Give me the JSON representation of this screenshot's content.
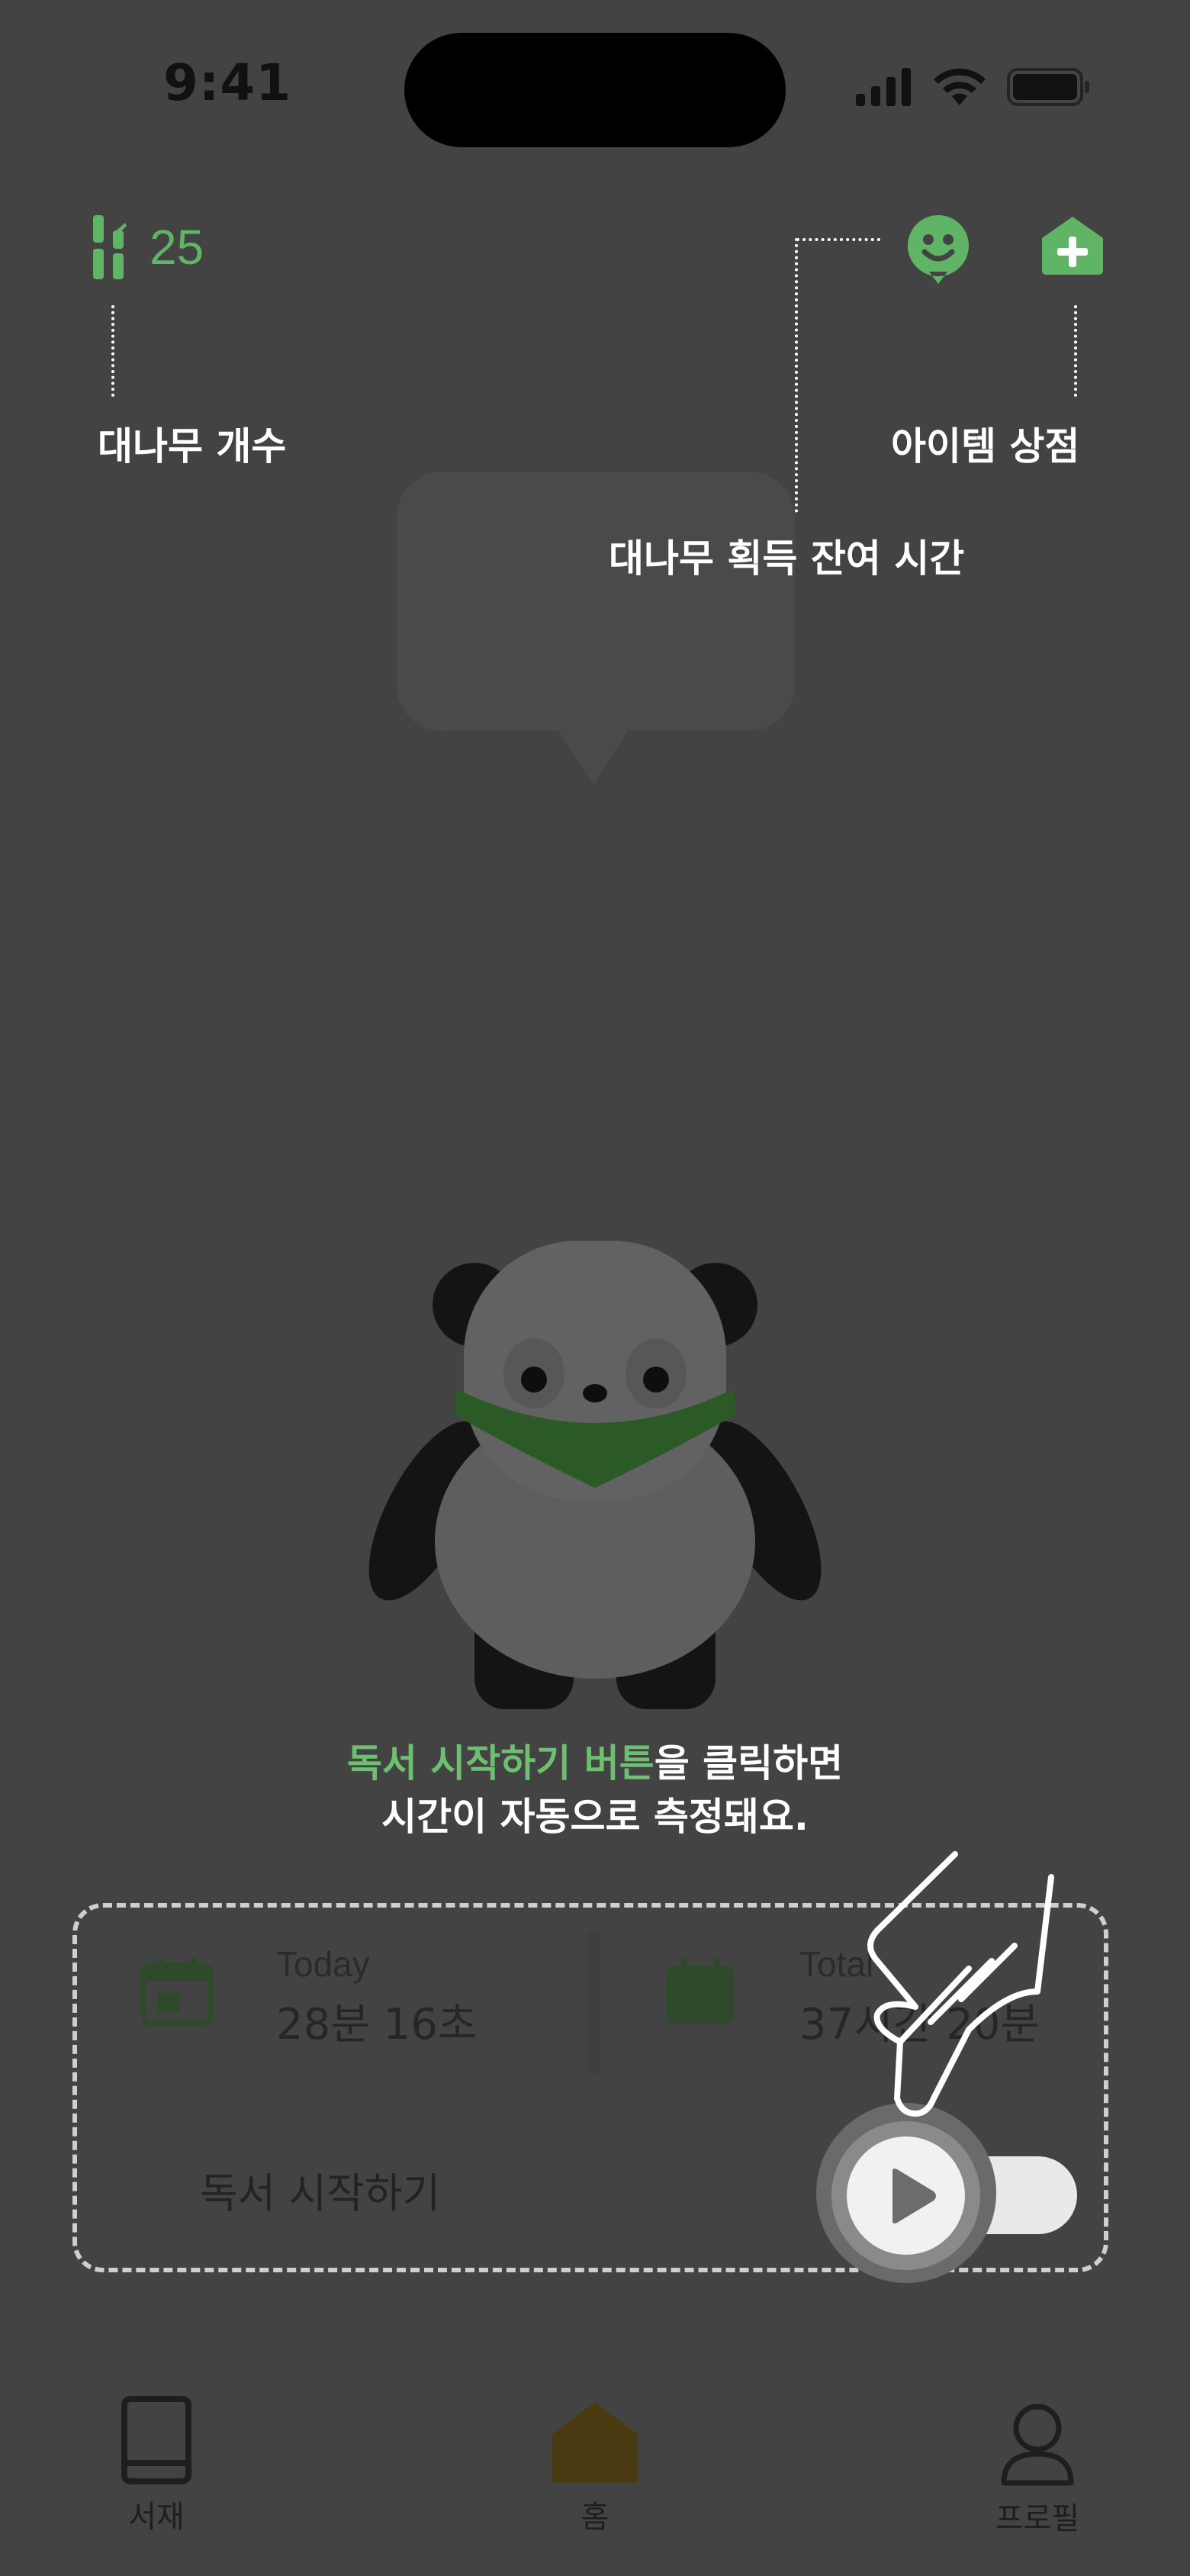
{
  "status_bar": {
    "time": "9:41"
  },
  "top_bar": {
    "bamboo_count": "25"
  },
  "annotations": {
    "bamboo_count_label": "대나무 개수",
    "item_shop_label": "아이템 상점",
    "bamboo_timer_label": "대나무 획득 잔여 시간"
  },
  "guide": {
    "highlight": "독서 시작하기 버튼",
    "rest_line1": "을 클릭하면",
    "line2": "시간이 자동으로 측정돼요."
  },
  "reading_card": {
    "today_label": "Today",
    "today_value": "28분 16초",
    "total_label": "Total",
    "total_value": "37시간 20분",
    "start_label": "독서 시작하기"
  },
  "bottom_nav": {
    "library": "서재",
    "home": "홈",
    "profile": "프로필"
  },
  "colors": {
    "accent_green": "#5fb565",
    "overlay_bg": "#434343",
    "home_active": "#4a3a12"
  }
}
